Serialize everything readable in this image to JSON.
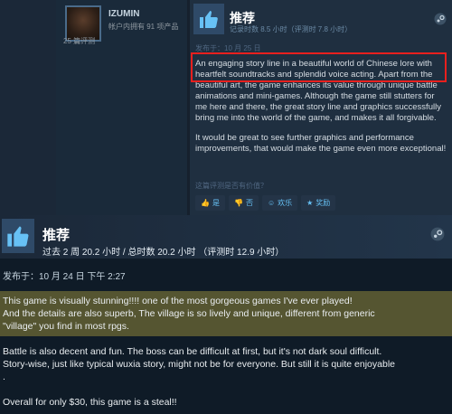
{
  "review_top": {
    "author_name": "IZUMIN",
    "owned_games": "帐户内拥有 91 项产品",
    "review_count": "25 篇评测",
    "title": "推荐",
    "hours": "记录时数 8.5 小时（评测时 7.8 小时）",
    "posted": "发布于：10 月 25 日",
    "paragraphs": [
      "An engaging story line in a beautiful world of Chinese lore with heartfelt soundtracks and splendid voice acting. Apart from the beautiful art, the game enhances its value through unique battle animations and mini-games. Although the game still stutters for me here and there, the great story line and graphics successfully bring me into the world of the game, and makes it all forgivable.",
      "It would be great to see further graphics and performance improvements, that would make the game even more exceptional!"
    ],
    "helpful_question": "这篇评测是否有价值？",
    "votes": [
      {
        "icon": "thumbs-up-icon",
        "label": "是"
      },
      {
        "icon": "thumbs-down-icon",
        "label": "否"
      },
      {
        "icon": "smile-icon",
        "label": "欢乐"
      },
      {
        "icon": "award-icon",
        "label": "奖励"
      }
    ]
  },
  "review_bottom": {
    "title": "推荐",
    "hours": "过去 2 周 20.2 小时 / 总时数 20.2 小时 （评测时 12.9 小时）",
    "posted": "发布于：10 月 24 日 下午 2:27",
    "para1": [
      "This game is visually stunning!!!! one of the most gorgeous games I've ever played!",
      "And the details are also superb, The village is so lively and unique, different from generic",
      "\"village\" you find in most rpgs."
    ],
    "para2": [
      "Battle is also decent and fun. The boss can be difficult at first, but it's not dark soul difficult.",
      "Story-wise, just like typical wuxia story, might not be for everyone. But still it is quite enjoyable",
      "."
    ],
    "para3": [
      "Overall for only $30, this game is a steal!!"
    ]
  },
  "colors": {
    "highlight_border": "#e8201e",
    "accent": "#66c0f4",
    "background": "#1b2838"
  }
}
